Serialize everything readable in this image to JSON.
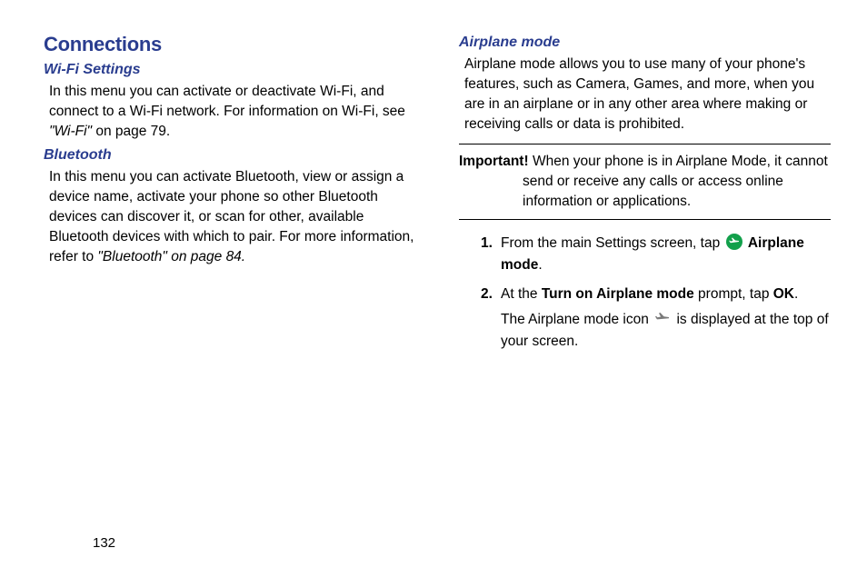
{
  "left": {
    "section_title": "Connections",
    "wifi": {
      "title": "Wi-Fi Settings",
      "body_pre": "In this menu you can activate or deactivate Wi-Fi, and connect to a Wi-Fi network. For information on Wi-Fi, see ",
      "ref": "\"Wi-Fi\"",
      "body_post": " on page 79."
    },
    "bluetooth": {
      "title": "Bluetooth",
      "body_pre": "In this menu you can activate Bluetooth, view or assign a device name, activate your phone so other Bluetooth devices can discover it, or scan for other, available Bluetooth devices with which to pair. For more information, refer to ",
      "ref": "\"Bluetooth\" on page 84."
    }
  },
  "right": {
    "airplane": {
      "title": "Airplane mode",
      "body": "Airplane mode allows you to use many of your phone's features, such as Camera, Games, and more, when you are in an airplane or in any other area where making or receiving calls or data is prohibited.",
      "important_label": "Important!",
      "important_text": " When your phone is in Airplane Mode, it cannot send or receive any calls or access online information or applications.",
      "step1_num": "1.",
      "step1_pre": "From the main Settings screen, tap ",
      "step1_bold": "Airplane mode",
      "step1_post": ".",
      "step2_num": "2.",
      "step2_pre": "At the ",
      "step2_bold1": "Turn on Airplane mode",
      "step2_mid": " prompt, tap ",
      "step2_bold2": "OK",
      "step2_post": ".",
      "step2_sub_pre": "The Airplane mode icon ",
      "step2_sub_post": " is displayed at the top of your screen."
    }
  },
  "page_number": "132"
}
